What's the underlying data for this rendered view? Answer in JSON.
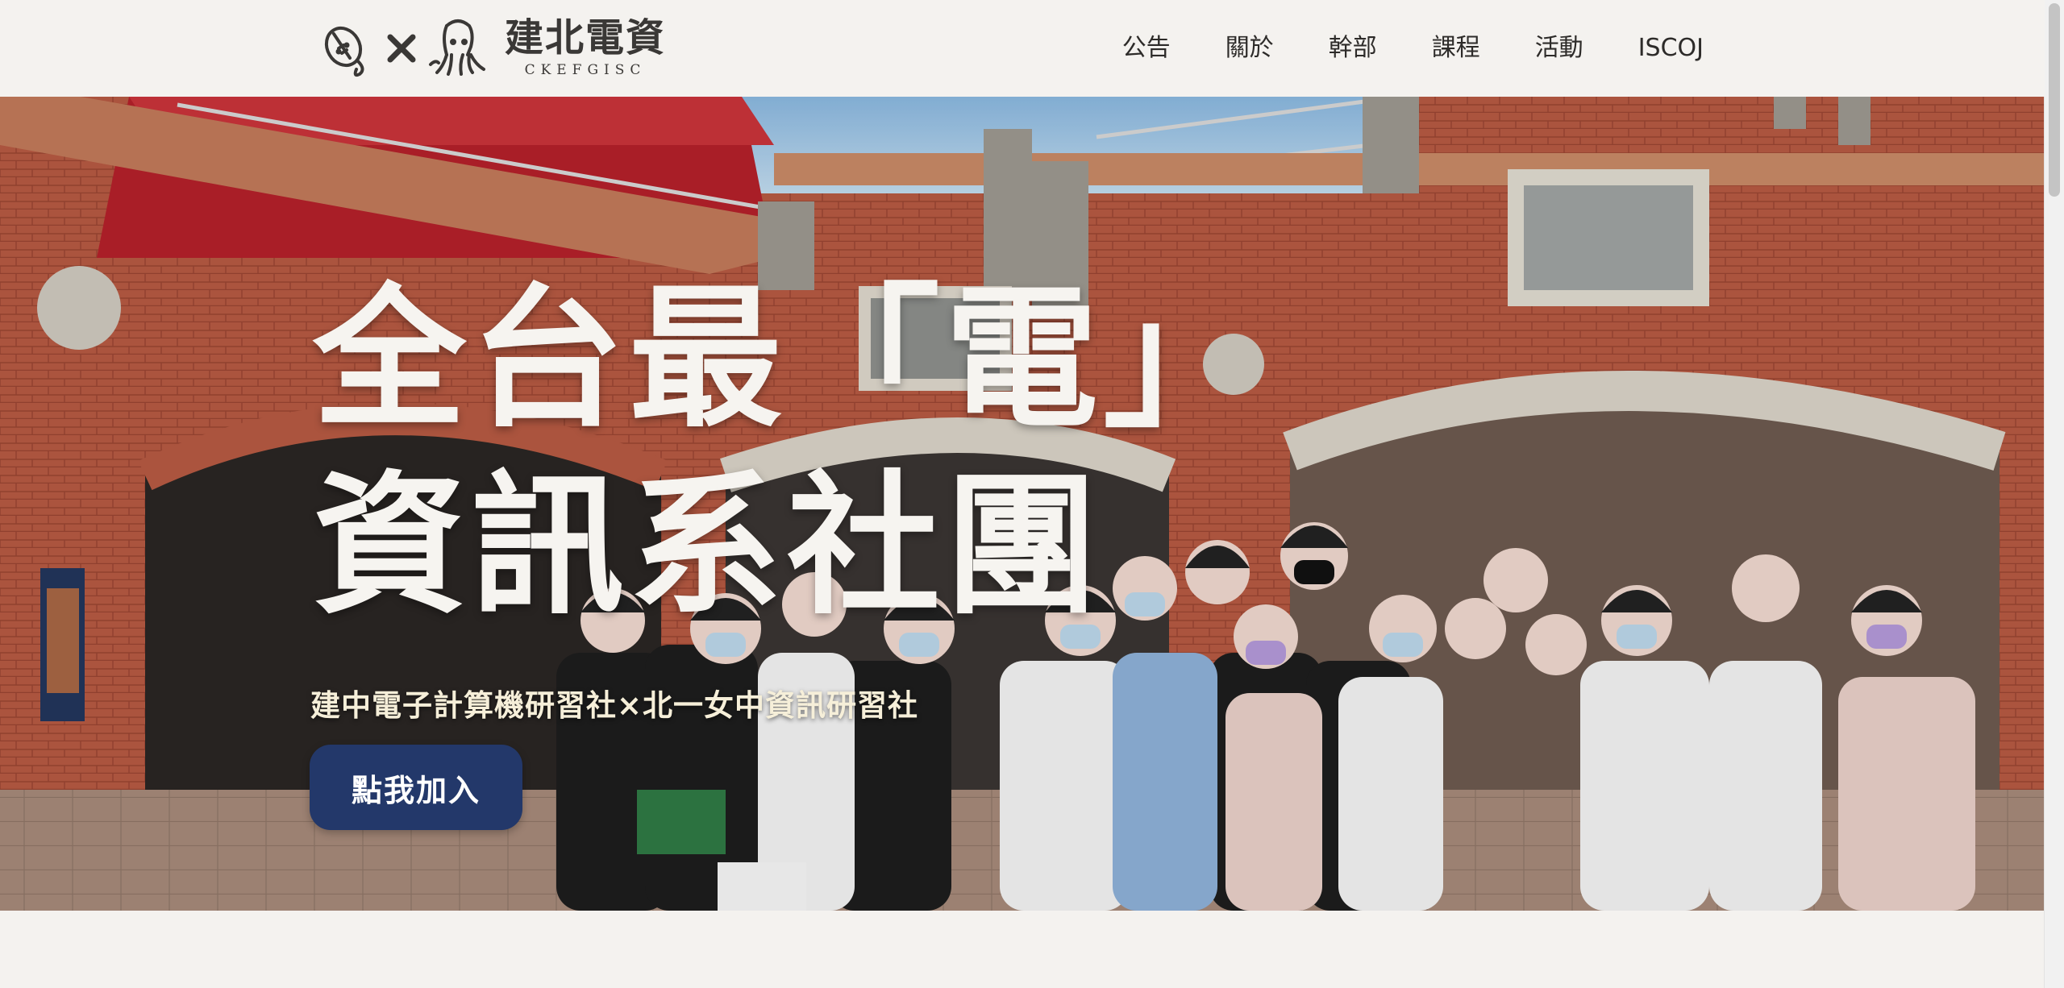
{
  "brand": {
    "title": "建北電資",
    "subtitle": "CKEFGISC",
    "logo_icons": [
      "mouse-mascot-icon",
      "cross-icon",
      "squid-mascot-icon"
    ]
  },
  "nav": {
    "items": [
      {
        "label": "公告"
      },
      {
        "label": "關於"
      },
      {
        "label": "幹部"
      },
      {
        "label": "課程"
      },
      {
        "label": "活動"
      },
      {
        "label": "ISCOJ"
      }
    ]
  },
  "hero": {
    "title_line1": "全台最「電」",
    "title_line2": "資訊系社團",
    "subtitle": "建中電子計算機研習社×北一女中資訊研習社",
    "cta_label": "點我加入"
  },
  "colors": {
    "background": "#f4f2ef",
    "cta": "#23386a",
    "brick": "#b6553d",
    "sky": "#9fc7e6"
  }
}
